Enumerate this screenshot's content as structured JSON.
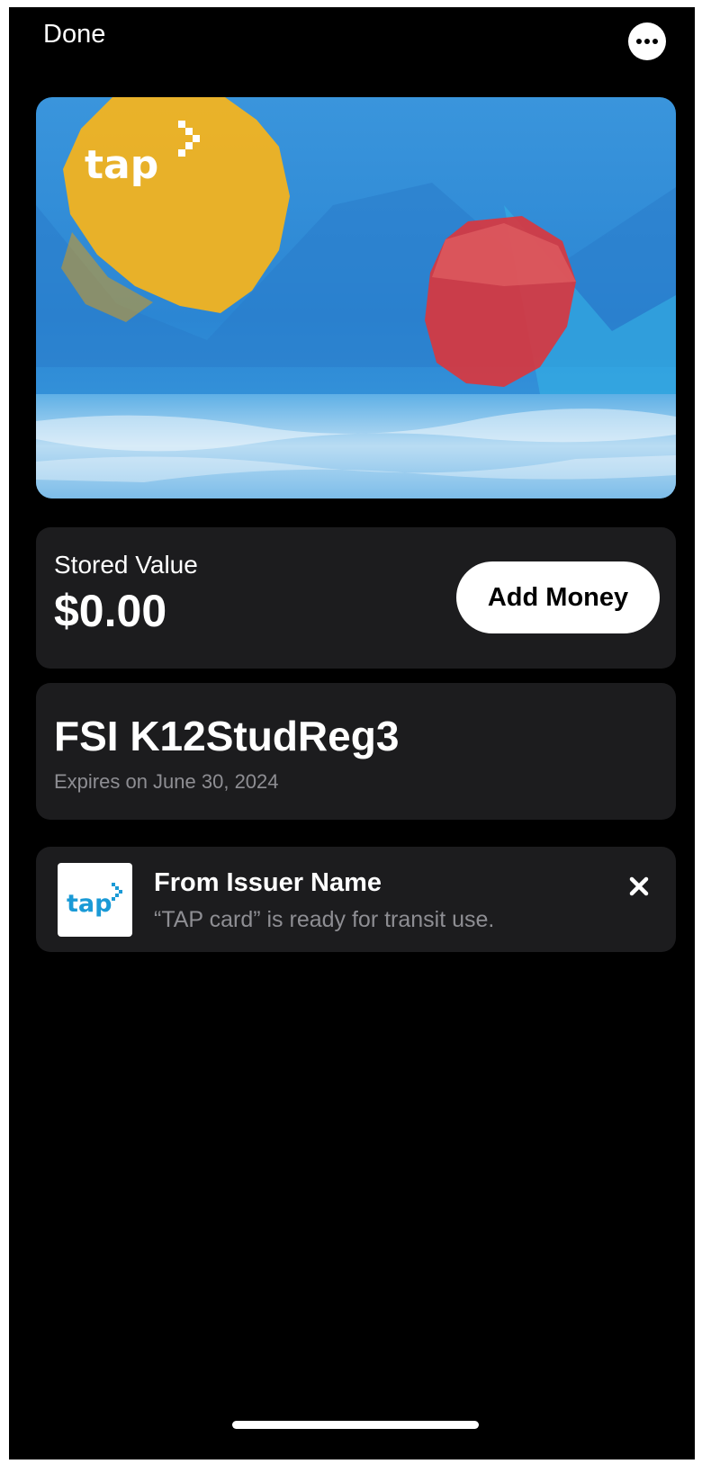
{
  "header": {
    "done_label": "Done",
    "more_icon": "ellipsis-circle-icon"
  },
  "card": {
    "logo_text": "tap",
    "colors": {
      "sky": "#2f8fdb",
      "sun_yellow": "#f2b320",
      "sun_red": "#d8373f",
      "water": "#c9e4f6"
    }
  },
  "stored_value": {
    "label": "Stored Value",
    "amount": "$0.00",
    "add_money_label": "Add Money"
  },
  "pass": {
    "name": "FSI K12StudReg3",
    "expiry": "Expires on June 30, 2024"
  },
  "notification": {
    "logo_text": "tap",
    "title": "From Issuer Name",
    "message": "“TAP card” is ready for transit use.",
    "dismiss_icon": "close-icon"
  },
  "colors": {
    "background": "#000000",
    "panel": "#1c1c1e",
    "secondary_text": "#8e8e93",
    "tap_blue": "#1a9ad6"
  }
}
